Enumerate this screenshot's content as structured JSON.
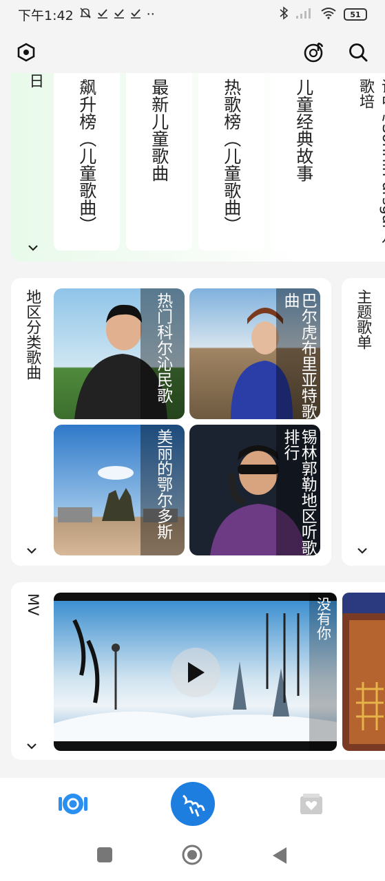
{
  "status_bar": {
    "time": "下午1:42",
    "dots": "··",
    "battery": "51"
  },
  "top_bar": {
    "settings_icon": "hexagon-gear-icon",
    "music_icon": "vinyl-music-icon",
    "search_icon": "search-icon"
  },
  "charts_section": {
    "label": "日",
    "lists": [
      {
        "title": "飙升榜（儿童歌曲）"
      },
      {
        "title": "最新儿童歌曲"
      },
      {
        "title": "热歌榜（儿童歌曲）"
      },
      {
        "title": "儿童经典故事"
      },
      {
        "title": "训中心Sonriin ursgal儿歌培"
      }
    ]
  },
  "region_section": {
    "label": "地区分类歌曲",
    "tiles": [
      {
        "caption": "热门科尔沁民歌"
      },
      {
        "caption": "巴尔虎布里亚特歌曲"
      },
      {
        "caption": "美丽的鄂尔多斯"
      },
      {
        "caption": "锡林郭勒地区听歌排行"
      }
    ]
  },
  "theme_section": {
    "label": "主题歌单"
  },
  "mv_section": {
    "label": "MV",
    "video": {
      "caption": "没有你"
    }
  },
  "colors": {
    "accent": "#1e7ee0",
    "nav_active": "#2b8ff0",
    "nav_inactive": "#c8c8c8"
  },
  "bottom_nav": {
    "items": [
      {
        "icon": "disc-icon"
      },
      {
        "icon": "mongolian-script-logo-icon"
      },
      {
        "icon": "heart-folder-icon"
      }
    ]
  },
  "system_nav": {
    "recents": "square-icon",
    "home": "circle-icon",
    "back": "triangle-back-icon"
  }
}
